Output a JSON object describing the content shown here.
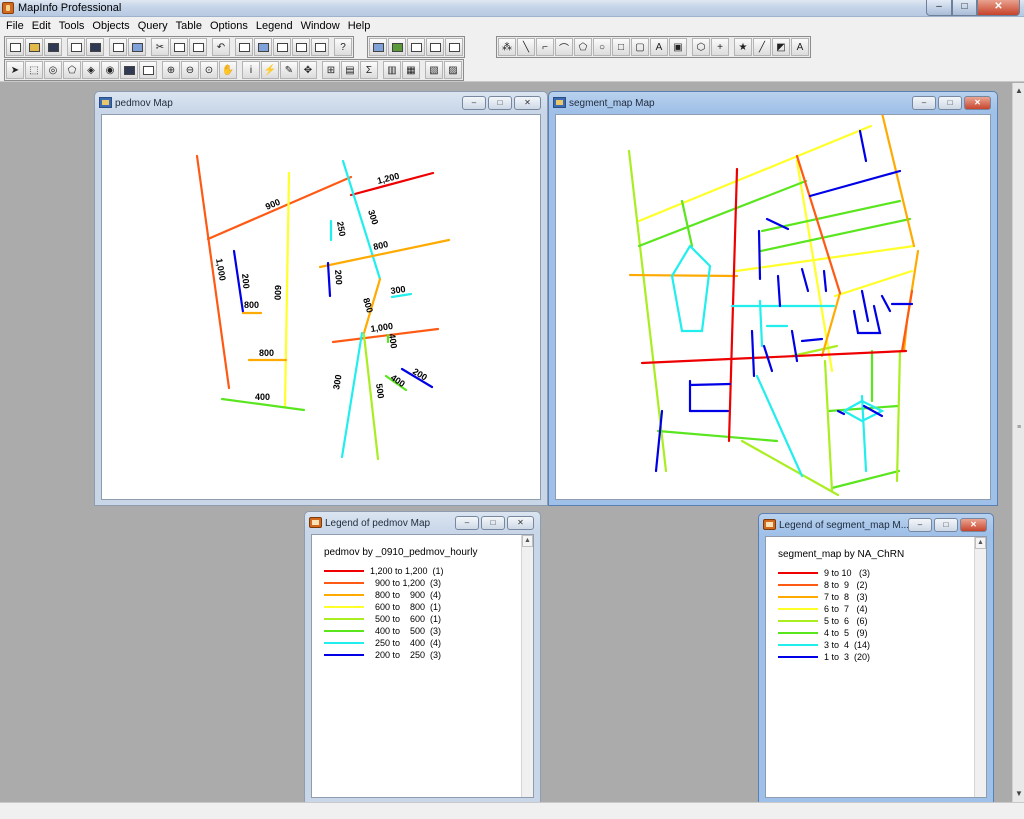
{
  "app": {
    "title": "MapInfo Professional"
  },
  "window_controls": {
    "minimize": "–",
    "maximize": "□",
    "close": "✕"
  },
  "menu": [
    "File",
    "Edit",
    "Tools",
    "Objects",
    "Query",
    "Table",
    "Options",
    "Legend",
    "Window",
    "Help"
  ],
  "colors": {
    "red": "#ee0000",
    "orange_red": "#ff5a14",
    "orange": "#ffaa00",
    "yellow": "#ffff2a",
    "yellow_green": "#aaee22",
    "green": "#5ae61e",
    "cyan": "#22eeee",
    "blue": "#0000e6"
  },
  "windows": {
    "pedmov_map": {
      "title": "pedmov Map"
    },
    "segment_map": {
      "title": "segment_map Map"
    },
    "pedmov_legend": {
      "title": "Legend of pedmov Map",
      "heading": "pedmov by _0910_pedmov_hourly",
      "rows": [
        {
          "label": "1,200 to 1,200  (1)",
          "color": "#ee0000"
        },
        {
          "label": "  900 to 1,200  (3)",
          "color": "#ff5a14"
        },
        {
          "label": "  800 to    900  (4)",
          "color": "#ffaa00"
        },
        {
          "label": "  600 to    800  (1)",
          "color": "#ffff2a"
        },
        {
          "label": "  500 to    600  (1)",
          "color": "#aaee22"
        },
        {
          "label": "  400 to    500  (3)",
          "color": "#5ae61e"
        },
        {
          "label": "  250 to    400  (4)",
          "color": "#22eeee"
        },
        {
          "label": "  200 to    250  (3)",
          "color": "#0000e6"
        }
      ]
    },
    "segment_legend": {
      "title": "Legend of segment_map M...",
      "heading": "segment_map by NA_ChRN",
      "rows": [
        {
          "label": "9 to 10   (3)",
          "color": "#ee0000"
        },
        {
          "label": "8 to  9   (2)",
          "color": "#ff5a14"
        },
        {
          "label": "7 to  8   (3)",
          "color": "#ffaa00"
        },
        {
          "label": "6 to  7   (4)",
          "color": "#ffff2a"
        },
        {
          "label": "5 to  6   (6)",
          "color": "#aaee22"
        },
        {
          "label": "4 to  5   (9)",
          "color": "#5ae61e"
        },
        {
          "label": "3 to  4  (14)",
          "color": "#22eeee"
        },
        {
          "label": "1 to  3  (20)",
          "color": "#0000e6"
        }
      ]
    }
  },
  "map_labels": {
    "l1200": "1,200",
    "l900": "900",
    "l1000a": "1,000",
    "l250": "250",
    "l300a": "300",
    "l800a": "800",
    "l200a": "200",
    "l200b": "200",
    "l600": "600",
    "l800b": "800",
    "l300b": "300",
    "l800c": "800",
    "l1000b": "1,000",
    "l400a": "400",
    "l800d": "800",
    "l200c": "200",
    "l400b": "400",
    "l300c": "300",
    "l500": "500"
  }
}
